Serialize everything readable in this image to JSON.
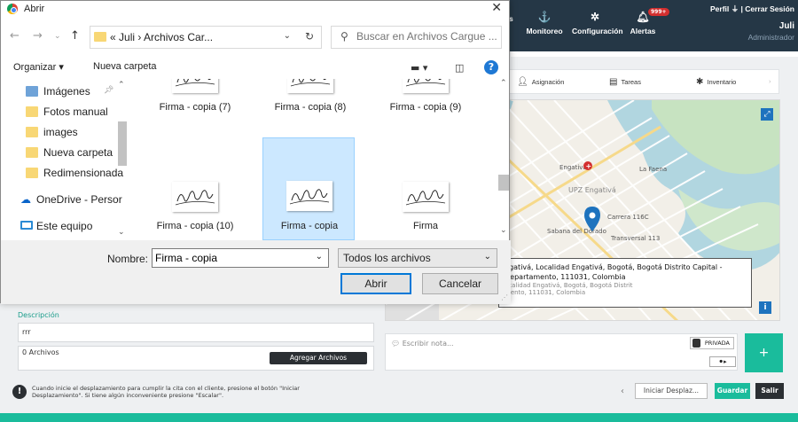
{
  "app": {
    "nav": [
      {
        "label": "s",
        "icon": ""
      },
      {
        "label": "Monitoreo",
        "icon": "monitor-icon"
      },
      {
        "label": "Configuración",
        "icon": "gear-icon"
      },
      {
        "label": "Alertas",
        "icon": "bell-icon"
      }
    ],
    "alerts_badge": "999+",
    "top_right": {
      "profile": "Perfil",
      "logout": "Cerrar Sesión",
      "user": "Juli",
      "role": "Administrador"
    },
    "tabs": [
      "Asignación",
      "Tareas",
      "Inventario"
    ],
    "map": {
      "tooltip_line1": "ngativá, Localidad Engativá, Bogotá, Bogotá Distrito Capital -",
      "tooltip_line2": "Departamento, 111031, Colombia",
      "tooltip_sub1": "ocalidad Engativá, Bogotá, Bogotá Distrit",
      "tooltip_sub2": "mento, 111031, Colombia",
      "labels": [
        "Engativá",
        "La Faena",
        "UPZ Engativá",
        "Sabana del Dorado",
        "Transversal 113",
        "Carrera 116C"
      ]
    },
    "description_label": "Descripción",
    "description_value": "rrr",
    "files_label": "0 Archivos",
    "add_files": "Agregar Archivos",
    "note_placeholder": "Escribir nota...",
    "private": "PRIVADA",
    "plus": "+",
    "footnote": "Cuando inicie el desplazamiento para cumplir la cita con el cliente, presione el botón \"Iniciar Desplazamiento\". Si tiene algún inconveniente presione \"Escalar\".",
    "btn_iniciar": "Iniciar Desplaz...",
    "btn_guardar": "Guardar",
    "btn_salir": "Salir"
  },
  "dialog": {
    "title": "Abrir",
    "path": [
      "Juli",
      "Archivos Car..."
    ],
    "search_placeholder": "Buscar en Archivos Cargue ...",
    "organize": "Organizar ▾",
    "new_folder": "Nueva carpeta",
    "nav_items": [
      {
        "label": "Imágenes",
        "icon": "pictures-icon",
        "pinned": true
      },
      {
        "label": "Fotos manual",
        "icon": "folder-icon"
      },
      {
        "label": "images",
        "icon": "folder-icon"
      },
      {
        "label": "Nueva carpeta",
        "icon": "folder-icon"
      },
      {
        "label": "Redimensionada",
        "icon": "folder-icon"
      },
      {
        "label": "OneDrive - Persor",
        "icon": "cloud-icon"
      },
      {
        "label": "Este equipo",
        "icon": "computer-icon"
      }
    ],
    "files": [
      {
        "name": "Firma - copia (7)",
        "selected": false
      },
      {
        "name": "Firma - copia (8)",
        "selected": false
      },
      {
        "name": "Firma - copia (9)",
        "selected": false
      },
      {
        "name": "Firma - copia (10)",
        "selected": false
      },
      {
        "name": "Firma - copia",
        "selected": true
      },
      {
        "name": "Firma",
        "selected": false
      }
    ],
    "filename_label": "Nombre:",
    "filename_value": "Firma - copia",
    "filter": "Todos los archivos",
    "open": "Abrir",
    "cancel": "Cancelar"
  },
  "colors": {
    "topbar": "#253746",
    "accent": "#1abc9c",
    "selection": "#cce8ff",
    "win_blue": "#0078d7"
  }
}
